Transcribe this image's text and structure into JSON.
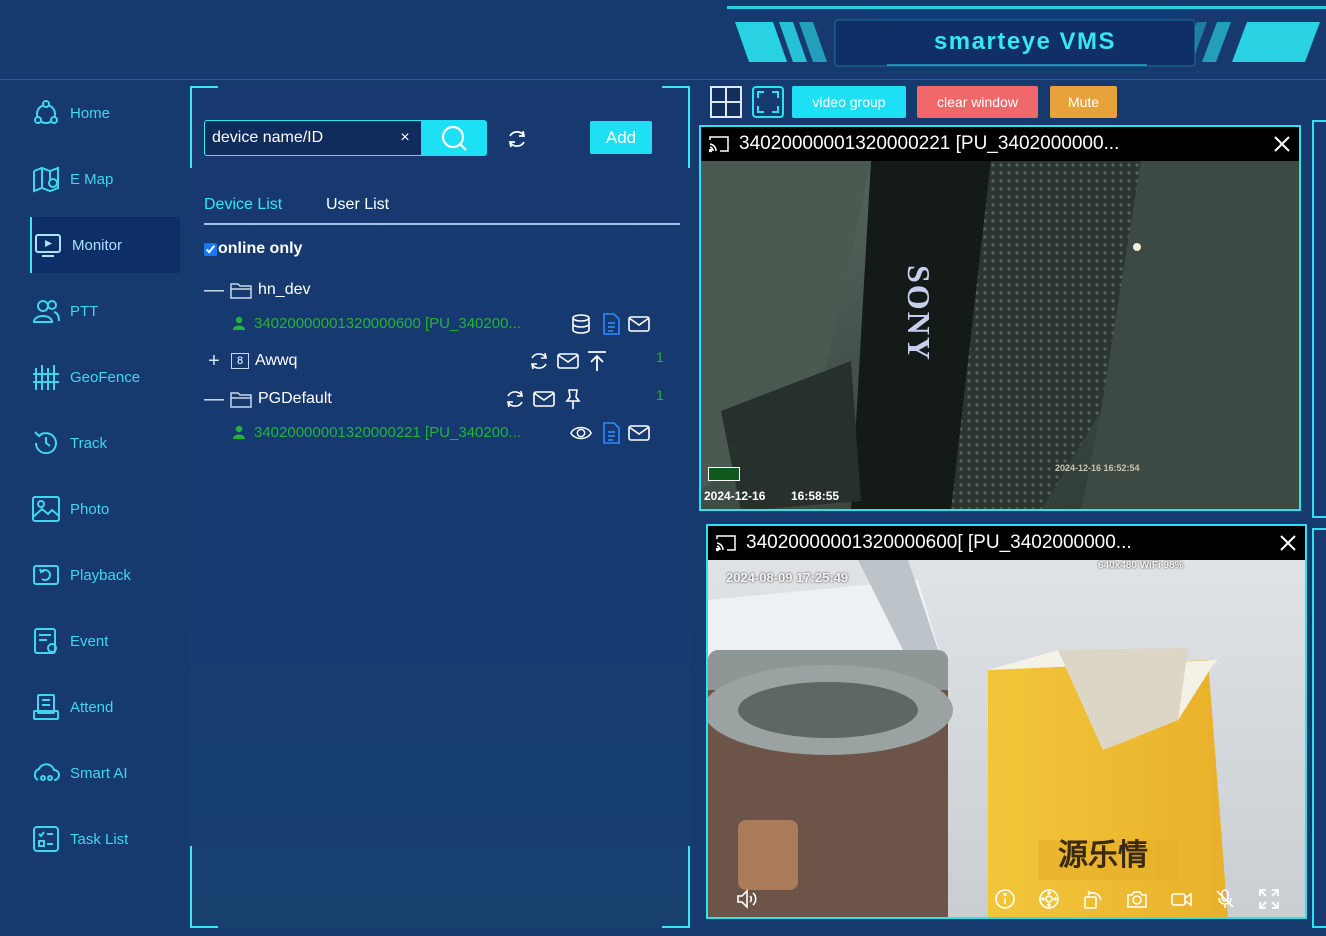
{
  "app": {
    "title": "smarteye VMS"
  },
  "sidebar": {
    "items": [
      {
        "label": "Home",
        "icon": "home-icon"
      },
      {
        "label": "E Map",
        "icon": "map-icon"
      },
      {
        "label": "Monitor",
        "icon": "monitor-icon",
        "active": true
      },
      {
        "label": "PTT",
        "icon": "ptt-users-icon"
      },
      {
        "label": "GeoFence",
        "icon": "geofence-icon"
      },
      {
        "label": "Track",
        "icon": "track-history-icon"
      },
      {
        "label": "Photo",
        "icon": "photo-icon"
      },
      {
        "label": "Playback",
        "icon": "playback-icon"
      },
      {
        "label": "Event",
        "icon": "event-icon"
      },
      {
        "label": "Attend",
        "icon": "attend-icon"
      },
      {
        "label": "Smart AI",
        "icon": "smart-ai-icon"
      },
      {
        "label": "Task List",
        "icon": "task-list-icon"
      }
    ]
  },
  "device_panel": {
    "search": {
      "placeholder": "device name/ID",
      "clear": "×"
    },
    "add_label": "Add",
    "tabs": {
      "device": "Device List",
      "user": "User List"
    },
    "online_only": "online only",
    "tree": {
      "groups": [
        {
          "name": "hn_dev",
          "toggle": "—",
          "devices": [
            "34020000001320000600 [PU_340200..."
          ]
        },
        {
          "name": "Awwq",
          "toggle": "+",
          "badge": "8",
          "count": "1"
        },
        {
          "name": "PGDefault",
          "toggle": "—",
          "count": "1",
          "devices": [
            "34020000001320000221 [PU_340200..."
          ]
        }
      ]
    }
  },
  "toolbar": {
    "video_group": "video group",
    "clear_window": "clear window",
    "mute": "Mute"
  },
  "videos": [
    {
      "title": "34020000001320000221 [PU_3402000000...",
      "osd_date": "2024-12-16",
      "osd_time": "16:58:55",
      "scene_text": "SONY",
      "scene_stamp": "2024-12-16   16:52:54"
    },
    {
      "title": "34020000001320000600[ [PU_3402000000...",
      "osd_datetime": "2024-08-09 17:25:49",
      "osd_status": "640x480   WiFi   98%",
      "scene_text": "源乐情"
    }
  ],
  "colors": {
    "accent": "#36e6f2",
    "button_cyan": "#1de0f5",
    "clear_window": "#f0686a",
    "mute": "#e8a23c",
    "online_green": "#22b33a",
    "background": "#173a6e"
  }
}
